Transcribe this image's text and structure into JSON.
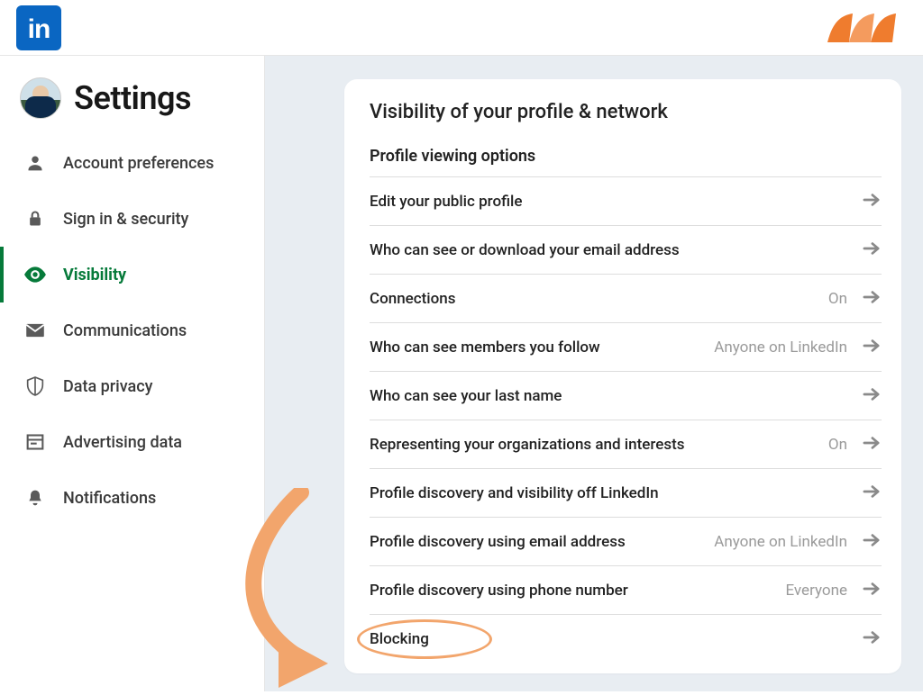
{
  "header": {
    "logo_text": "in"
  },
  "sidebar": {
    "title": "Settings",
    "items": [
      {
        "label": "Account preferences",
        "icon": "person-icon",
        "active": false
      },
      {
        "label": "Sign in & security",
        "icon": "lock-icon",
        "active": false
      },
      {
        "label": "Visibility",
        "icon": "eye-icon",
        "active": true
      },
      {
        "label": "Communications",
        "icon": "mail-icon",
        "active": false
      },
      {
        "label": "Data privacy",
        "icon": "shield-icon",
        "active": false
      },
      {
        "label": "Advertising data",
        "icon": "window-icon",
        "active": false
      },
      {
        "label": "Notifications",
        "icon": "bell-icon",
        "active": false
      }
    ]
  },
  "main": {
    "section_title": "Visibility of your profile & network",
    "group_title": "Profile viewing options",
    "rows": [
      {
        "label": "Edit your public profile",
        "value": ""
      },
      {
        "label": "Who can see or download your email address",
        "value": ""
      },
      {
        "label": "Connections",
        "value": "On"
      },
      {
        "label": "Who can see members you follow",
        "value": "Anyone on LinkedIn"
      },
      {
        "label": "Who can see your last name",
        "value": ""
      },
      {
        "label": "Representing your organizations and interests",
        "value": "On"
      },
      {
        "label": "Profile discovery and visibility off LinkedIn",
        "value": ""
      },
      {
        "label": "Profile discovery using email address",
        "value": "Anyone on LinkedIn"
      },
      {
        "label": "Profile discovery using phone number",
        "value": "Everyone"
      },
      {
        "label": "Blocking",
        "value": "",
        "highlight": true
      }
    ]
  },
  "annotation": {
    "color": "#f2a56c"
  }
}
